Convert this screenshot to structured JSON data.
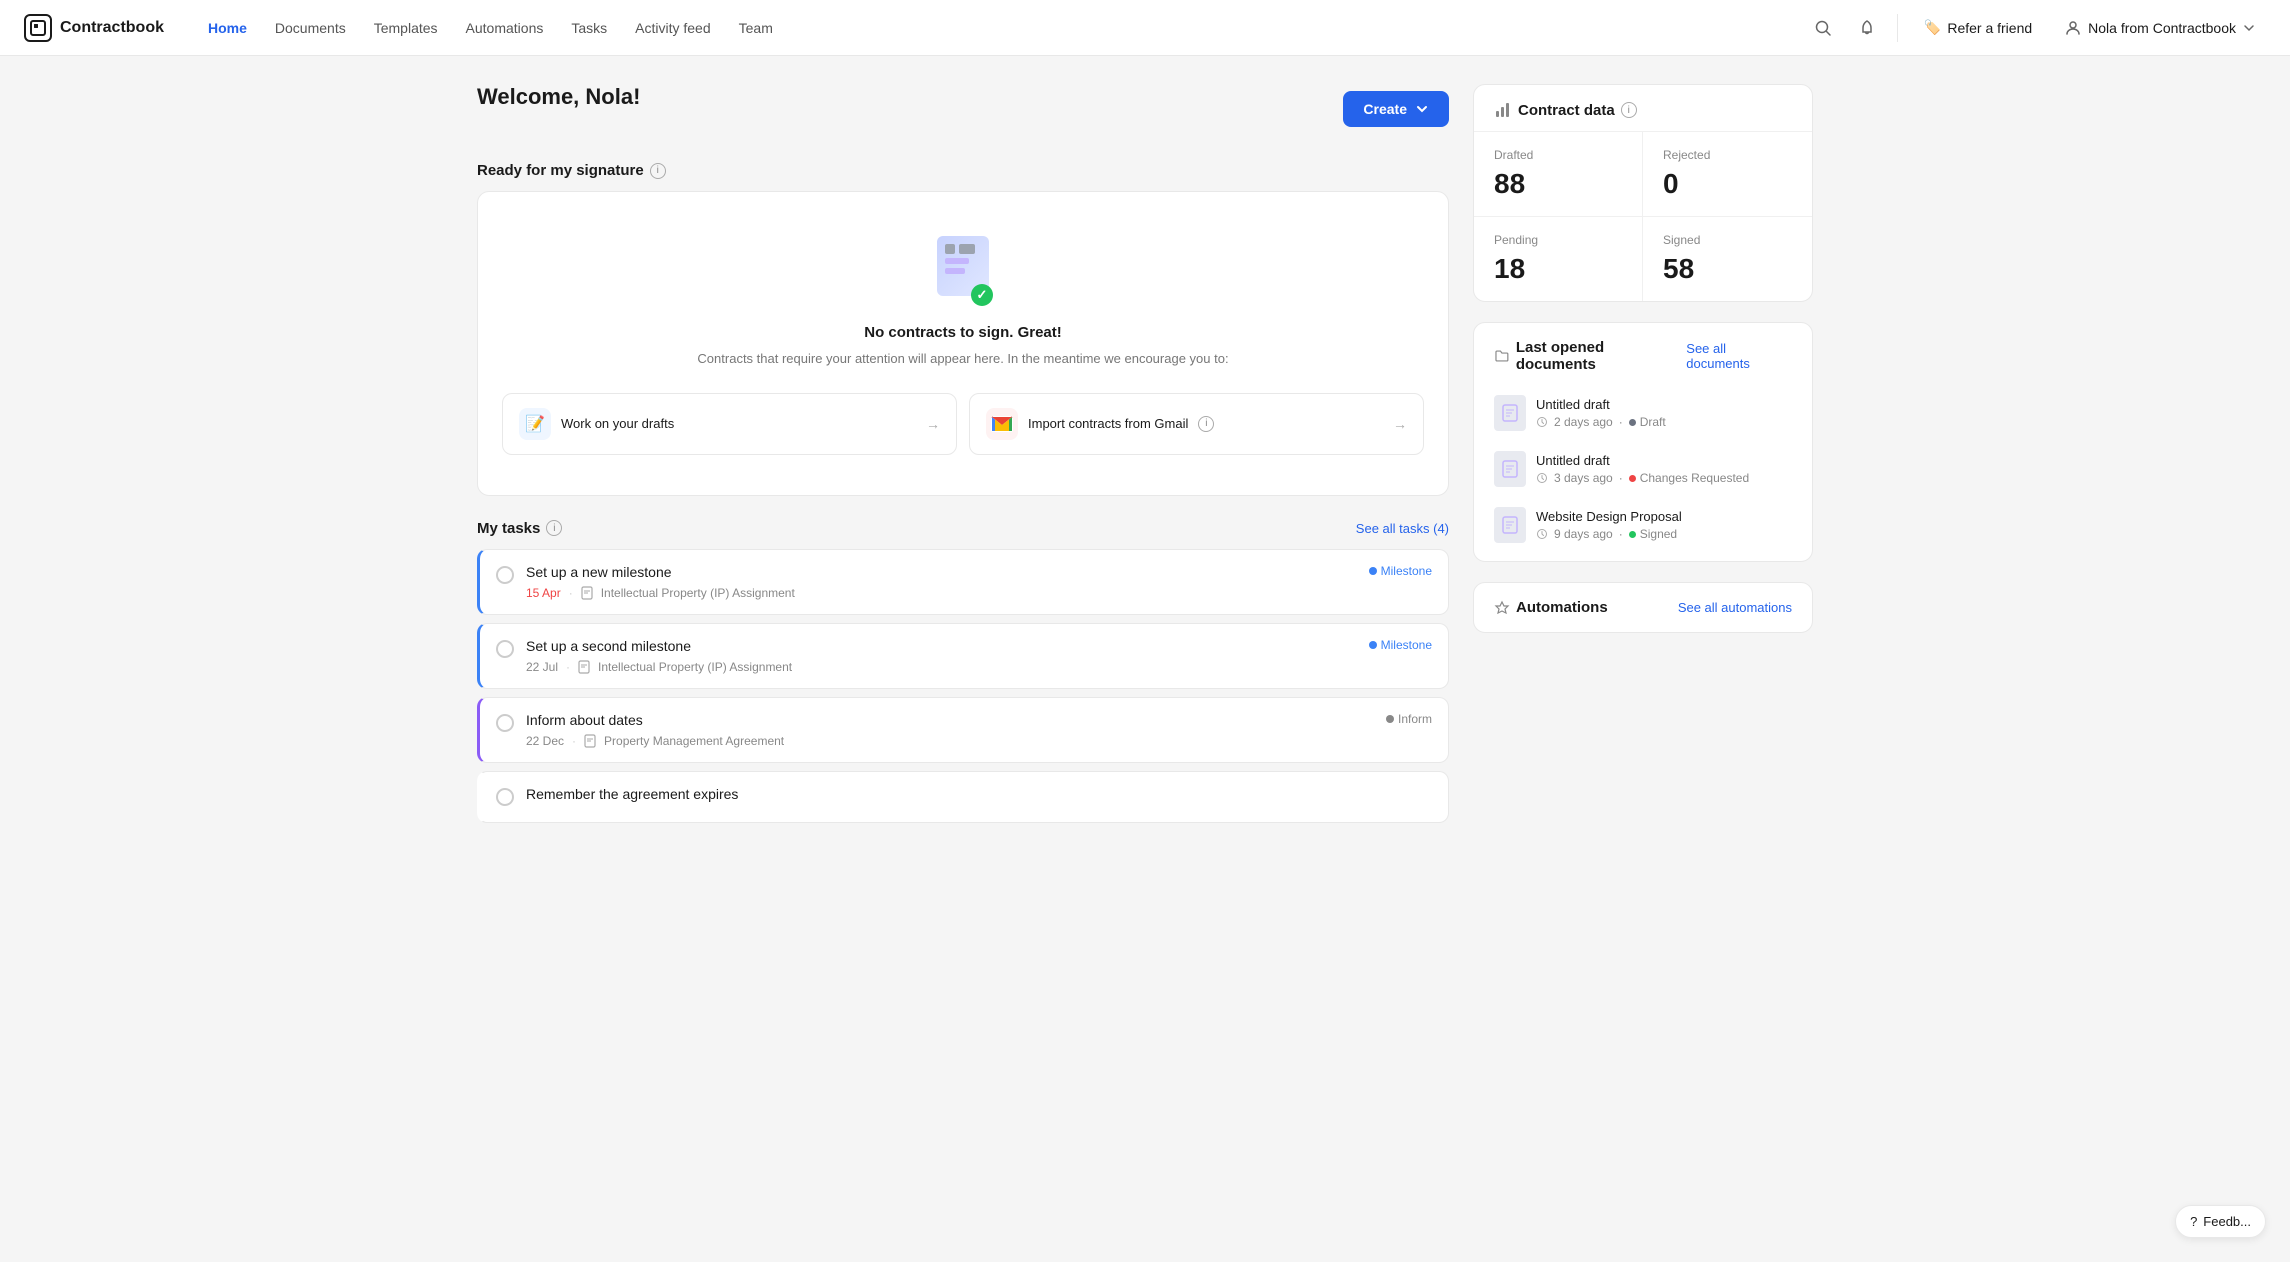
{
  "brand": {
    "icon": "CB",
    "name": "Contractbook"
  },
  "nav": {
    "links": [
      {
        "label": "Home",
        "active": true
      },
      {
        "label": "Documents",
        "active": false
      },
      {
        "label": "Templates",
        "active": false
      },
      {
        "label": "Automations",
        "active": false
      },
      {
        "label": "Tasks",
        "active": false
      },
      {
        "label": "Activity feed",
        "active": false
      },
      {
        "label": "Team",
        "active": false
      }
    ],
    "refer_label": "Refer a friend",
    "user_label": "Nola from Contractbook"
  },
  "page": {
    "welcome": "Welcome, Nola!",
    "create_label": "Create"
  },
  "ready_section": {
    "title": "Ready for my signature",
    "empty_title": "No contracts to sign. Great!",
    "empty_desc": "Contracts that require your attention will appear here. In the meantime we encourage you to:",
    "actions": [
      {
        "label": "Work on your drafts",
        "icon": "📝",
        "type": "blue"
      },
      {
        "label": "Import contracts from Gmail",
        "icon": "✉️",
        "type": "gmail"
      }
    ]
  },
  "tasks_section": {
    "title": "My tasks",
    "see_all_label": "See all tasks (4)",
    "items": [
      {
        "title": "Set up a new milestone",
        "date": "15 Apr",
        "date_color": "red",
        "doc": "Intellectual Property (IP) Assignment",
        "badge": "Milestone",
        "badge_type": "milestone"
      },
      {
        "title": "Set up a second milestone",
        "date": "22 Jul",
        "date_color": "gray",
        "doc": "Intellectual Property (IP) Assignment",
        "badge": "Milestone",
        "badge_type": "milestone"
      },
      {
        "title": "Inform about dates",
        "date": "22 Dec",
        "date_color": "gray",
        "doc": "Property Management Agreement",
        "badge": "Inform",
        "badge_type": "inform"
      },
      {
        "title": "Remember the agreement expires",
        "date": "",
        "date_color": "gray",
        "doc": "",
        "badge": "",
        "badge_type": ""
      }
    ]
  },
  "contract_data": {
    "title": "Contract data",
    "cells": [
      {
        "label": "Drafted",
        "value": "88"
      },
      {
        "label": "Rejected",
        "value": "0"
      },
      {
        "label": "Pending",
        "value": "18"
      },
      {
        "label": "Signed",
        "value": "58"
      }
    ]
  },
  "last_opened": {
    "title": "Last opened documents",
    "see_all_label": "See all documents",
    "docs": [
      {
        "name": "Untitled draft",
        "age": "2 days ago",
        "status": "Draft",
        "status_type": "draft"
      },
      {
        "name": "Untitled draft",
        "age": "3 days ago",
        "status": "Changes Requested",
        "status_type": "changes"
      },
      {
        "name": "Website Design Proposal",
        "age": "9 days ago",
        "status": "Signed",
        "status_type": "signed"
      }
    ]
  },
  "automations": {
    "title": "Automations",
    "see_all_label": "See all automations"
  },
  "feedback": {
    "label": "Feedb..."
  }
}
